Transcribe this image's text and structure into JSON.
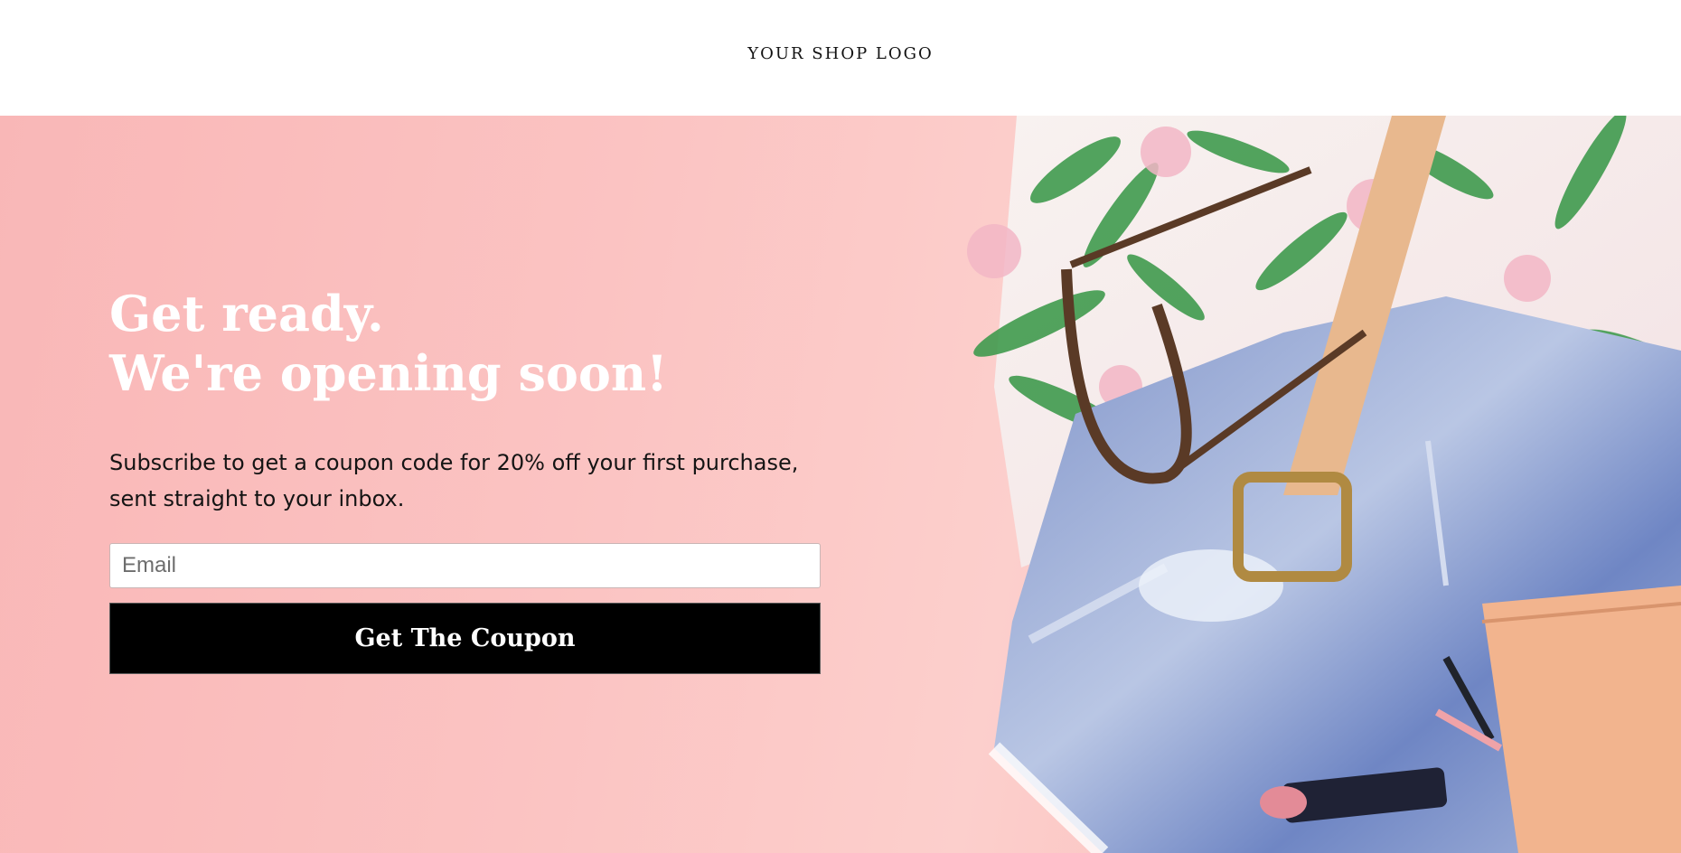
{
  "header": {
    "logo_text": "YOUR SHOP LOGO"
  },
  "hero": {
    "headline_line1": "Get ready.",
    "headline_line2": "We're opening soon!",
    "subtext": "Subscribe to get a coupon code for 20% off your first purchase, sent straight to your inbox.",
    "email_placeholder": "Email",
    "button_label": "Get The Coupon",
    "image": "flat-lay photo of tropical shirt, sunglasses, denim shorts, belt, lipstick and beige wallet"
  },
  "colors": {
    "background_pink": "#fbc3c2",
    "headline": "#ffffff",
    "button_bg": "#000000",
    "button_text": "#ffffff"
  }
}
